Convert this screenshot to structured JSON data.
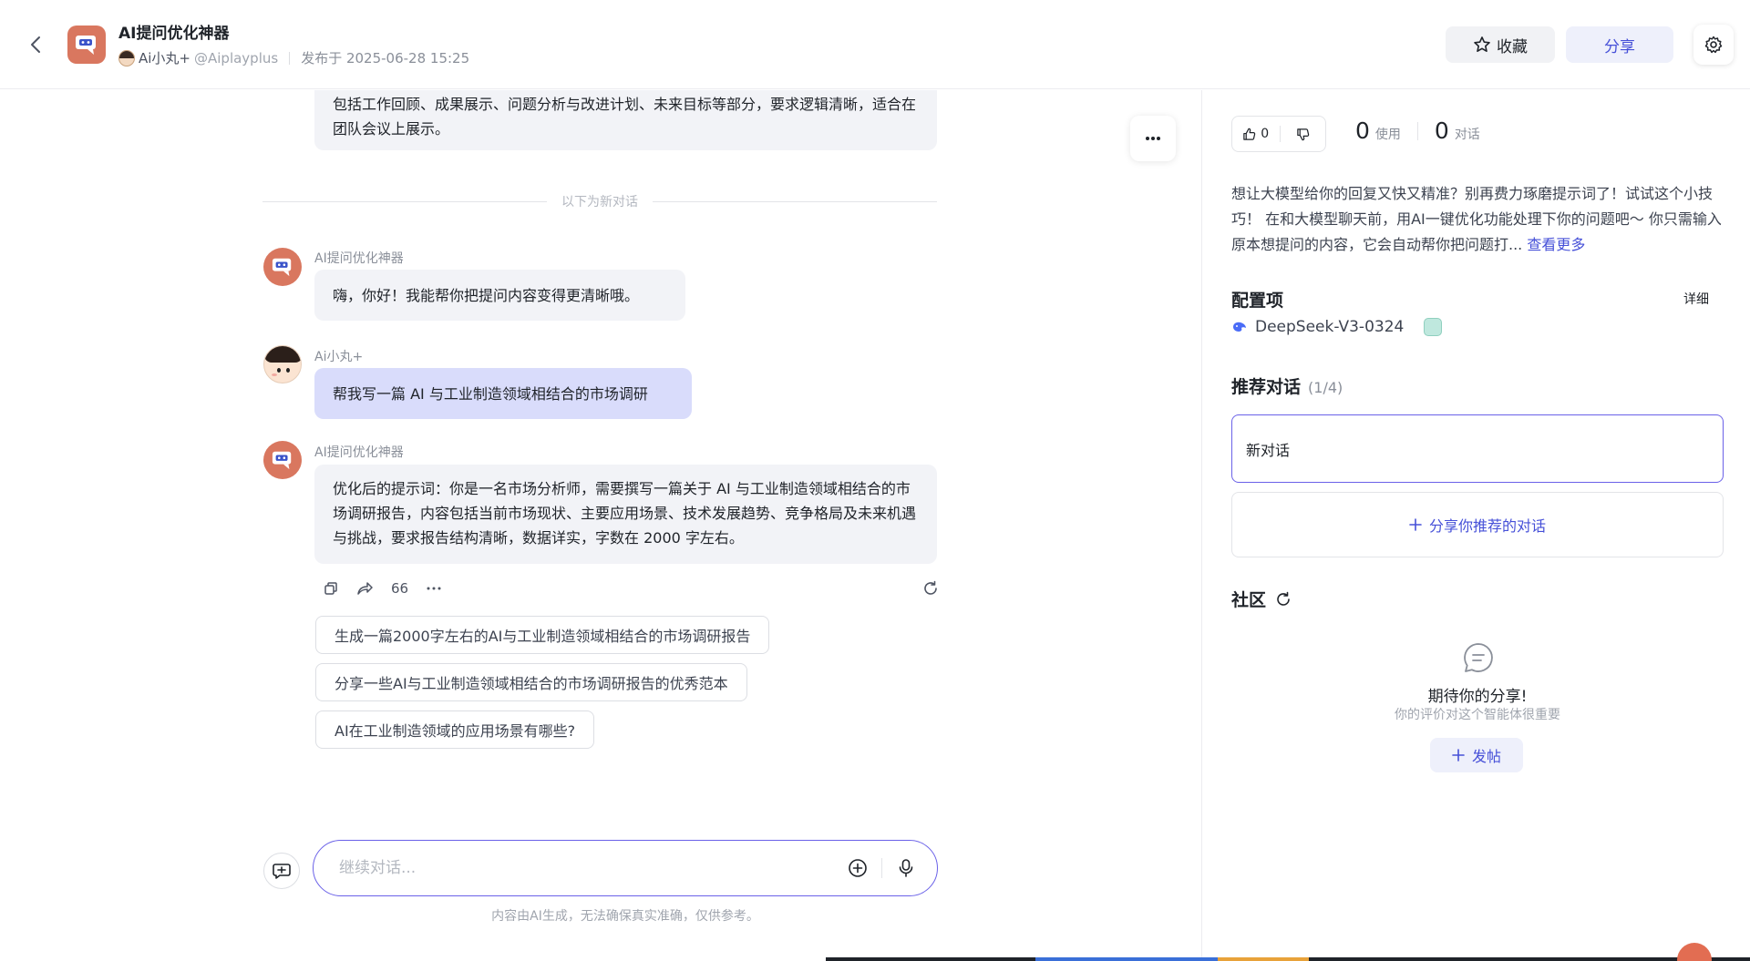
{
  "header": {
    "title": "AI提问优化神器",
    "author_name": "Ai小丸+",
    "author_handle": "@Aiplayplus",
    "published": "发布于 2025-06-28 15:25",
    "favorite_label": "收藏",
    "share_label": "分享",
    "icons": {
      "back": "chevron-left-icon",
      "favorite": "star-icon",
      "settings": "gear-icon"
    }
  },
  "chat": {
    "previous_message_tail": "包括工作回顾、成果展示、问题分析与改进计划、未来目标等部分，要求逻辑清晰，适合在团队会议上展示。",
    "divider_text": "以下为新对话",
    "messages": [
      {
        "sender": "AI提问优化神器",
        "role": "bot",
        "text": "嗨，你好！我能帮你把提问内容变得更清晰哦。"
      },
      {
        "sender": "Ai小丸+",
        "role": "user",
        "text": "帮我写一篇 AI 与工业制造领域相结合的市场调研"
      },
      {
        "sender": "AI提问优化神器",
        "role": "bot",
        "text": "优化后的提示词：你是一名市场分析师，需要撰写一篇关于 AI 与工业制造领域相结合的市场调研报告，内容包括当前市场现状、主要应用场景、技术发展趋势、竞争格局及未来机遇与挑战，要求报告结构清晰，数据详实，字数在 2000 字左右。"
      }
    ],
    "action_quote_label": "66",
    "suggestions": [
      "生成一篇2000字左右的AI与工业制造领域相结合的市场调研报告",
      "分享一些AI与工业制造领域相结合的市场调研报告的优秀范本",
      "AI在工业制造领域的应用场景有哪些?"
    ],
    "input_placeholder": "继续对话...",
    "disclaimer": "内容由AI生成，无法确保真实准确，仅供参考。"
  },
  "panel": {
    "like_count": "0",
    "use_count": "0",
    "use_label": "使用",
    "dialog_count": "0",
    "dialog_label": "对话",
    "description": "想让大模型给你的回复又快又精准？别再费力琢磨提示词了！试试这个小技巧！ 在和大模型聊天前，用AI一键优化功能处理下你的问题吧～ 你只需输入原本想提问的内容，它会自动帮你把问题打...",
    "see_more": "查看更多",
    "config_title": "配置项",
    "config_detail": "详细",
    "model_name": "DeepSeek-V3-0324",
    "recommend_title": "推荐对话",
    "recommend_count": "(1/4)",
    "recommend_item": "新对话",
    "share_recommend_label": "分享你推荐的对话",
    "community_title": "社区",
    "empty_title": "期待你的分享!",
    "empty_sub": "你的评价对这个智能体很重要",
    "post_label": "发帖"
  },
  "colors": {
    "accent": "#4650d8",
    "input_border": "#6a61e8",
    "user_bubble": "#d9dcfb",
    "bot_avatar": "#d9775f"
  }
}
